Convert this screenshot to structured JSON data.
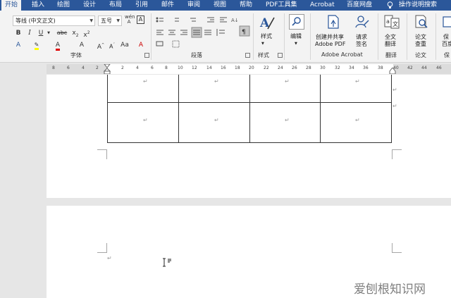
{
  "tabs": [
    "开始",
    "插入",
    "绘图",
    "设计",
    "布局",
    "引用",
    "邮件",
    "审阅",
    "视图",
    "帮助",
    "PDF工具集",
    "Acrobat",
    "百度网盘",
    "操作说明搜索"
  ],
  "font": {
    "name": "等线 (中文正文)",
    "size": "五号",
    "group_label": "字体"
  },
  "paragraph": {
    "group_label": "段落"
  },
  "styles": {
    "button_label": "样式",
    "group_label": "样式"
  },
  "editing": {
    "button_label": "编辑"
  },
  "acrobat": {
    "create_share_line1": "创建并共享",
    "create_share_line2": "Adobe PDF",
    "request_sign_line1": "请求",
    "request_sign_line2": "签名",
    "group_label": "Adobe Acrobat"
  },
  "translate": {
    "line1": "全文",
    "line2": "翻译",
    "group_label": "翻译"
  },
  "paper": {
    "line1": "论文",
    "line2": "查重",
    "group_label": "论文"
  },
  "save_partial": {
    "line1": "保",
    "line2": "百度",
    "group_label": "保"
  },
  "ruler_numbers": [
    "8",
    "6",
    "4",
    "2",
    "2",
    "4",
    "6",
    "8",
    "10",
    "12",
    "14",
    "16",
    "18",
    "20",
    "22",
    "24",
    "26",
    "28",
    "30",
    "32",
    "34",
    "36",
    "38",
    "40",
    "42",
    "44",
    "46"
  ],
  "table": {
    "rows": 2,
    "cols": 4
  },
  "paragraph_mark": "↵",
  "watermark": "爱刨根知识网",
  "colors": {
    "tab_bar": "#2b579a",
    "ribbon": "#f3f3f3",
    "canvas": "#e6e6e6"
  }
}
